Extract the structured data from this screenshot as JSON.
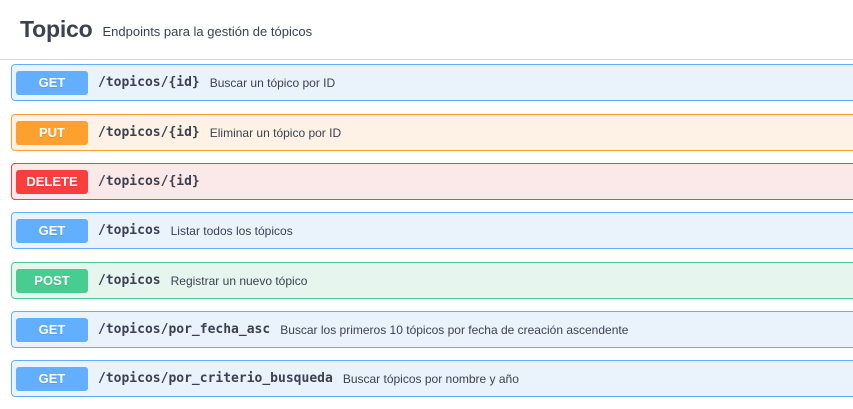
{
  "tag": {
    "name": "Topico",
    "description": "Endpoints para la gestión de tópicos"
  },
  "operations": [
    {
      "method": "GET",
      "path": "/topicos/{id}",
      "summary": "Buscar un tópico por ID",
      "color": "#61affe"
    },
    {
      "method": "PUT",
      "path": "/topicos/{id}",
      "summary": "Eliminar un tópico por ID",
      "color": "#fca130"
    },
    {
      "method": "DELETE",
      "path": "/topicos/{id}",
      "summary": "",
      "color": "#f93e3e"
    },
    {
      "method": "GET",
      "path": "/topicos",
      "summary": "Listar todos los tópicos",
      "color": "#61affe"
    },
    {
      "method": "POST",
      "path": "/topicos",
      "summary": "Registrar un nuevo tópico",
      "color": "#49cc90"
    },
    {
      "method": "GET",
      "path": "/topicos/por_fecha_asc",
      "summary": "Buscar los primeros 10 tópicos por fecha de creación ascendente",
      "color": "#61affe"
    },
    {
      "method": "GET",
      "path": "/topicos/por_criterio_busqueda",
      "summary": "Buscar tópicos por nombre y año",
      "color": "#61affe"
    }
  ]
}
